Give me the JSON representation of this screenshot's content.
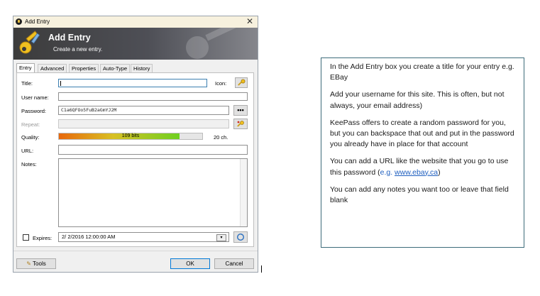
{
  "window": {
    "title": "Add Entry",
    "close_glyph": "✕"
  },
  "banner": {
    "title": "Add Entry",
    "subtitle": "Create a new entry."
  },
  "tabs": [
    {
      "label": "Entry",
      "active": true
    },
    {
      "label": "Advanced",
      "active": false
    },
    {
      "label": "Properties",
      "active": false
    },
    {
      "label": "Auto-Type",
      "active": false
    },
    {
      "label": "History",
      "active": false
    }
  ],
  "form": {
    "title_label": "Title:",
    "icon_label": "Icon:",
    "username_label": "User name:",
    "password_label": "Password:",
    "password_value": "C1a6QFOo5FuB2aGmYJ2M",
    "password_dots": "•••",
    "repeat_label": "Repeat:",
    "quality_label": "Quality:",
    "quality_text": "109 bits",
    "quality_fraction": 0.84,
    "chars_text": "20 ch.",
    "url_label": "URL:",
    "notes_label": "Notes:",
    "expires_label": "Expires:",
    "expires_value": "2/  2/2016 12:00:00 AM"
  },
  "footer": {
    "tools_label": "Tools",
    "ok_label": "OK",
    "cancel_label": "Cancel"
  },
  "icons": {
    "key_icon": "key-icon",
    "generator_icon": "password-generator-icon",
    "calendar_icon": "calendar-dropdown-icon",
    "refresh_icon": "refresh-icon",
    "tools_icon": "tools-icon"
  },
  "colors": {
    "banner_dark": "#3c3c3c",
    "quality_start": "#e8680c",
    "quality_end": "#6ed020",
    "infobox_border": "#3d6b7a",
    "link": "#1f5fbf"
  },
  "infobox": {
    "p1": "In the Add Entry box you create a title for your entry e.g. EBay",
    "p2": "Add your username for this site. This is often, but not always, your email address)",
    "p3": "KeePass offers to create a random password for you, but you can backspace that out and put in the password you already have in place for that account",
    "p4_before": "You can add a URL like the website that you go to use this password (",
    "p4_eg": "e.g. ",
    "p4_link": "www.ebay.ca",
    "p4_after": ")",
    "p5": "You can add any notes you want too or leave that field blank"
  }
}
